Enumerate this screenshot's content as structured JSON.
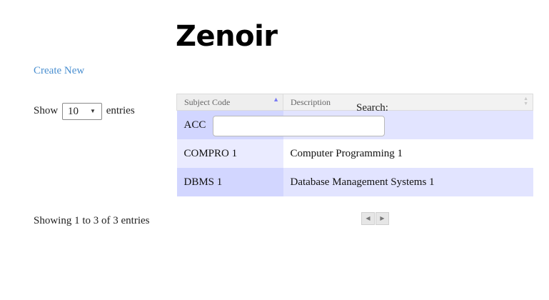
{
  "header": {
    "brand": "Zenoir"
  },
  "actions": {
    "create_new": "Create New"
  },
  "length_menu": {
    "prefix": "Show",
    "selected": "10",
    "suffix": "entries"
  },
  "filter": {
    "label": "Search:",
    "value": ""
  },
  "table": {
    "columns": [
      "Subject Code",
      "Description"
    ],
    "rows": [
      {
        "code": "ACC",
        "description": ""
      },
      {
        "code": "COMPRO 1",
        "description": "Computer Programming 1"
      },
      {
        "code": "DBMS 1",
        "description": "Database Management Systems 1"
      }
    ]
  },
  "footer": {
    "info": "Showing 1 to 3 of 3 entries"
  },
  "icons": {
    "sort_asc": "sort-ascending-icon",
    "sort_both": "sort-both-icon",
    "prev": "previous-page-icon",
    "next": "next-page-icon",
    "dropdown": "chevron-down-icon"
  }
}
